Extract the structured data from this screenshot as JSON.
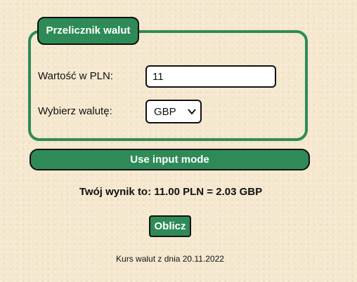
{
  "converter": {
    "title": "Przelicznik walut",
    "amount_label": "Wartość w PLN:",
    "amount_value": "11",
    "currency_label": "Wybierz walutę:",
    "selected_currency": "GBP",
    "mode_button_label": "Use input mode",
    "result_text": "Twój wynik to: 11.00 PLN = 2.03 GBP",
    "calculate_label": "Oblicz",
    "rate_date_text": "Kurs walut z dnia 20.11.2022"
  },
  "theme": {
    "accent": "#2e8b57",
    "background": "#f5e8cf"
  },
  "icons": {
    "currency_select": "chevron-down-icon"
  }
}
